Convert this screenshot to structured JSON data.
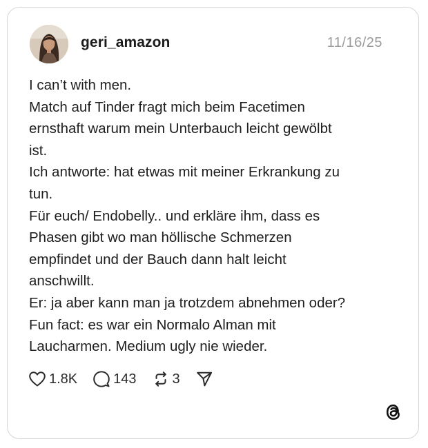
{
  "post": {
    "username": "geri_amazon",
    "date": "11/16/25",
    "lines": [
      "I can’t with men.",
      "Match auf Tinder fragt mich beim Facetimen",
      "ernsthaft warum mein Unterbauch leicht gewölbt",
      "ist.",
      "Ich antworte: hat etwas mit meiner Erkrankung zu",
      "tun.",
      "Für euch/ Endobelly.. und erkläre ihm, dass es",
      "Phasen gibt wo man höllische Schmerzen",
      "empfindet und der Bauch dann halt leicht",
      "anschwillt.",
      "Er: ja aber kann man ja trotzdem abnehmen oder?",
      "Fun fact: es war ein Normalo Alman mit",
      "Laucharmen. Medium ugly nie wieder."
    ]
  },
  "actions": {
    "likes": "1.8K",
    "comments": "143",
    "reposts": "3"
  },
  "icons": {
    "like": "heart-icon",
    "comment": "comment-bubble-icon",
    "repost": "repost-icon",
    "share": "send-icon",
    "brand": "threads-logo-icon"
  },
  "colors": {
    "text": "#1e1e1e",
    "date": "#9a9a9a",
    "border": "#d6d6d6"
  }
}
